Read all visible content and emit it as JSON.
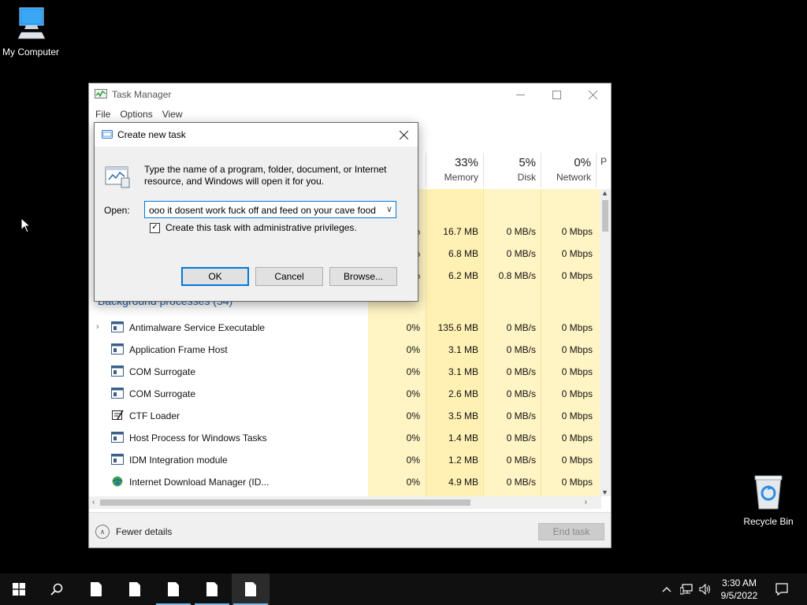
{
  "desktop": {
    "icons": [
      {
        "label": "My Computer",
        "icon": "computer-icon"
      },
      {
        "label": "Recycle Bin",
        "icon": "recycle-bin-icon"
      }
    ]
  },
  "task_manager": {
    "title": "Task Manager",
    "menu": [
      "File",
      "Options",
      "View"
    ],
    "columns": [
      {
        "pct": "33%",
        "name": "Memory"
      },
      {
        "pct": "5%",
        "name": "Disk"
      },
      {
        "pct": "0%",
        "name": "Network"
      },
      {
        "pct": "",
        "name": "P"
      }
    ],
    "apps_rows": [
      {
        "mem": "16.7 MB",
        "disk": "0 MB/s",
        "net": "0 Mbps"
      },
      {
        "mem": "6.8 MB",
        "disk": "0 MB/s",
        "net": "0 Mbps"
      },
      {
        "mem": "6.2 MB",
        "disk": "0.8 MB/s",
        "net": "0 Mbps"
      }
    ],
    "section_heading": "Background processes (54)",
    "processes": [
      {
        "name": "Antimalware Service Executable",
        "cpu": "0%",
        "mem": "135.6 MB",
        "disk": "0 MB/s",
        "net": "0 Mbps",
        "icon": "service-icon",
        "expandable": true
      },
      {
        "name": "Application Frame Host",
        "cpu": "0%",
        "mem": "3.1 MB",
        "disk": "0 MB/s",
        "net": "0 Mbps",
        "icon": "service-icon",
        "expandable": false
      },
      {
        "name": "COM Surrogate",
        "cpu": "0%",
        "mem": "3.1 MB",
        "disk": "0 MB/s",
        "net": "0 Mbps",
        "icon": "service-icon",
        "expandable": false
      },
      {
        "name": "COM Surrogate",
        "cpu": "0%",
        "mem": "2.6 MB",
        "disk": "0 MB/s",
        "net": "0 Mbps",
        "icon": "service-icon",
        "expandable": false
      },
      {
        "name": "CTF Loader",
        "cpu": "0%",
        "mem": "3.5 MB",
        "disk": "0 MB/s",
        "net": "0 Mbps",
        "icon": "ctf-loader-icon",
        "expandable": false
      },
      {
        "name": "Host Process for Windows Tasks",
        "cpu": "0%",
        "mem": "1.4 MB",
        "disk": "0 MB/s",
        "net": "0 Mbps",
        "icon": "service-icon",
        "expandable": false
      },
      {
        "name": "IDM Integration module",
        "cpu": "0%",
        "mem": "1.2 MB",
        "disk": "0 MB/s",
        "net": "0 Mbps",
        "icon": "service-icon",
        "expandable": false
      },
      {
        "name": "Internet Download Manager (ID...",
        "cpu": "0%",
        "mem": "4.9 MB",
        "disk": "0 MB/s",
        "net": "0 Mbps",
        "icon": "idm-globe-icon",
        "expandable": false
      }
    ],
    "footer": {
      "fewer_details": "Fewer details",
      "end_task": "End task"
    }
  },
  "dialog": {
    "title": "Create new task",
    "description": "Type the name of a program, folder, document, or Internet resource, and Windows will open it for you.",
    "open_label": "Open:",
    "open_value": "ooo it dosent work fuck off and feed on your cave food",
    "admin_checkbox_label": "Create this task with administrative privileges.",
    "admin_checked": true,
    "buttons": {
      "ok": "OK",
      "cancel": "Cancel",
      "browse": "Browse..."
    }
  },
  "taskbar": {
    "time": "3:30 AM",
    "date": "9/5/2022",
    "open_apps": 5
  }
}
